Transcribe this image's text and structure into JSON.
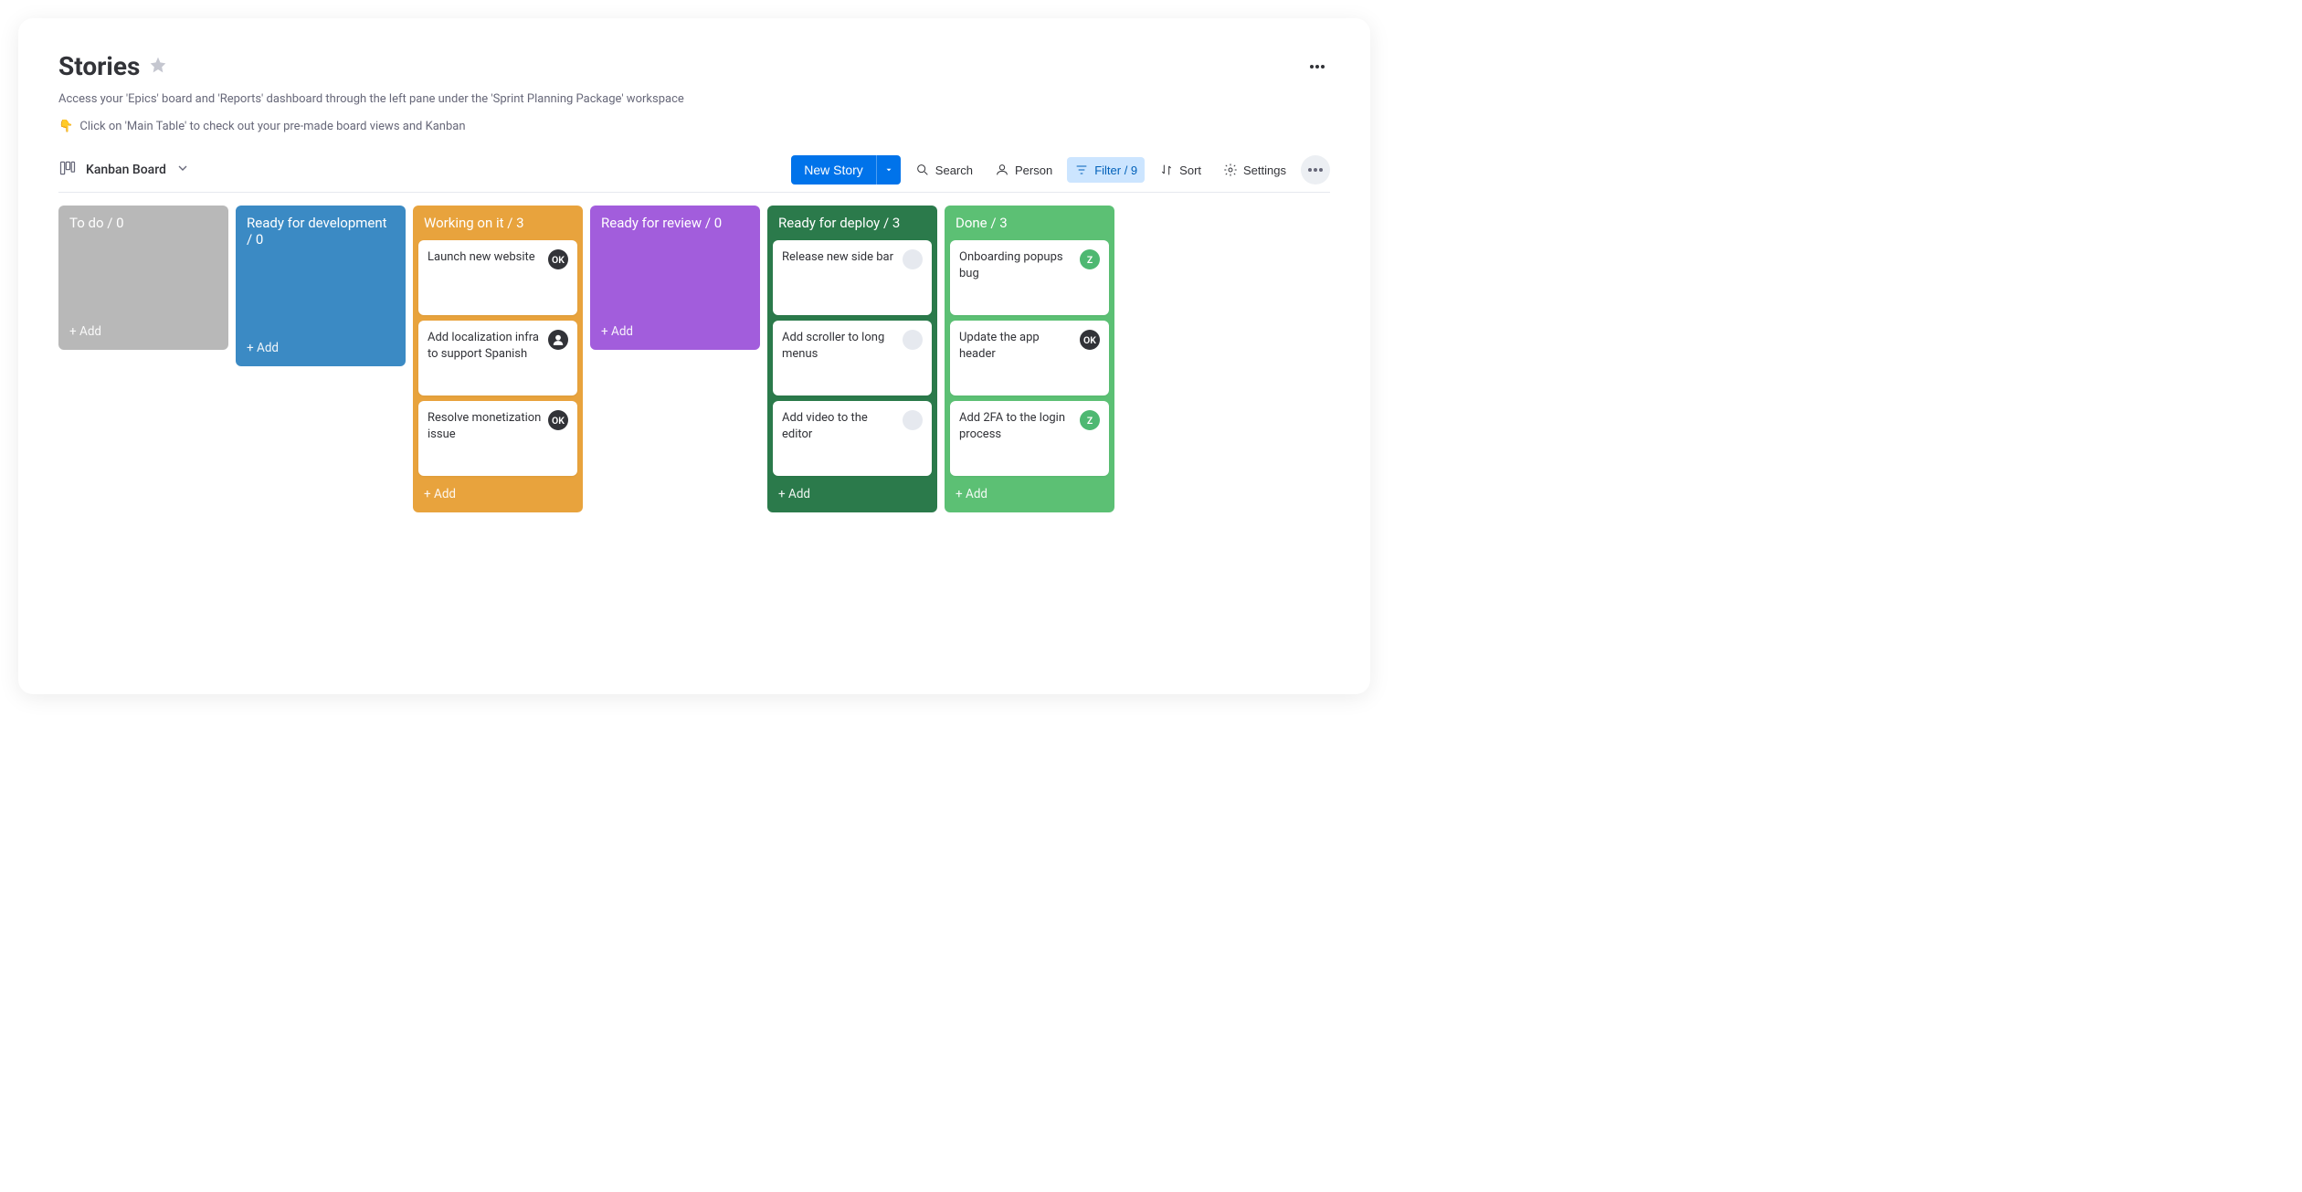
{
  "header": {
    "title": "Stories",
    "subtitle_line1": "Access your 'Epics' board and 'Reports' dashboard through the left pane under the 'Sprint Planning Package' workspace",
    "subtitle_emoji": "👇",
    "subtitle_line2": "Click on 'Main Table' to check out your pre-made board views and Kanban"
  },
  "view": {
    "label": "Kanban Board"
  },
  "toolbar": {
    "primary_label": "New Story",
    "search_label": "Search",
    "person_label": "Person",
    "filter_label": "Filter / 9",
    "sort_label": "Sort",
    "settings_label": "Settings"
  },
  "columns": [
    {
      "id": "todo",
      "title": "To do",
      "count": 0,
      "color": "col-todo",
      "cards": [],
      "add_label": "+ Add"
    },
    {
      "id": "ready-dev",
      "title": "Ready for development",
      "count": 0,
      "color": "col-ready-dev",
      "cards": [],
      "add_label": "+ Add"
    },
    {
      "id": "working",
      "title": "Working on it",
      "count": 3,
      "color": "col-working",
      "cards": [
        {
          "text": "Launch new website",
          "avatar": "ok",
          "avatar_text": "OK"
        },
        {
          "text": "Add localization infra to support Spanish",
          "avatar": "user",
          "avatar_text": ""
        },
        {
          "text": "Resolve monetization issue",
          "avatar": "ok",
          "avatar_text": "OK"
        }
      ],
      "add_label": "+ Add"
    },
    {
      "id": "review",
      "title": "Ready for review",
      "count": 0,
      "color": "col-review",
      "cards": [],
      "add_label": "+ Add"
    },
    {
      "id": "deploy",
      "title": "Ready for deploy",
      "count": 3,
      "color": "col-deploy",
      "cards": [
        {
          "text": "Release new side bar",
          "avatar": "blank",
          "avatar_text": ""
        },
        {
          "text": "Add scroller to long menus",
          "avatar": "blank",
          "avatar_text": ""
        },
        {
          "text": "Add video to the editor",
          "avatar": "blank",
          "avatar_text": ""
        }
      ],
      "add_label": "+ Add"
    },
    {
      "id": "done",
      "title": "Done",
      "count": 3,
      "color": "col-done",
      "cards": [
        {
          "text": "Onboarding popups bug",
          "avatar": "z",
          "avatar_text": "Z"
        },
        {
          "text": "Update the app header",
          "avatar": "ok",
          "avatar_text": "OK"
        },
        {
          "text": "Add 2FA to the login process",
          "avatar": "z",
          "avatar_text": "Z"
        }
      ],
      "add_label": "+ Add"
    }
  ]
}
